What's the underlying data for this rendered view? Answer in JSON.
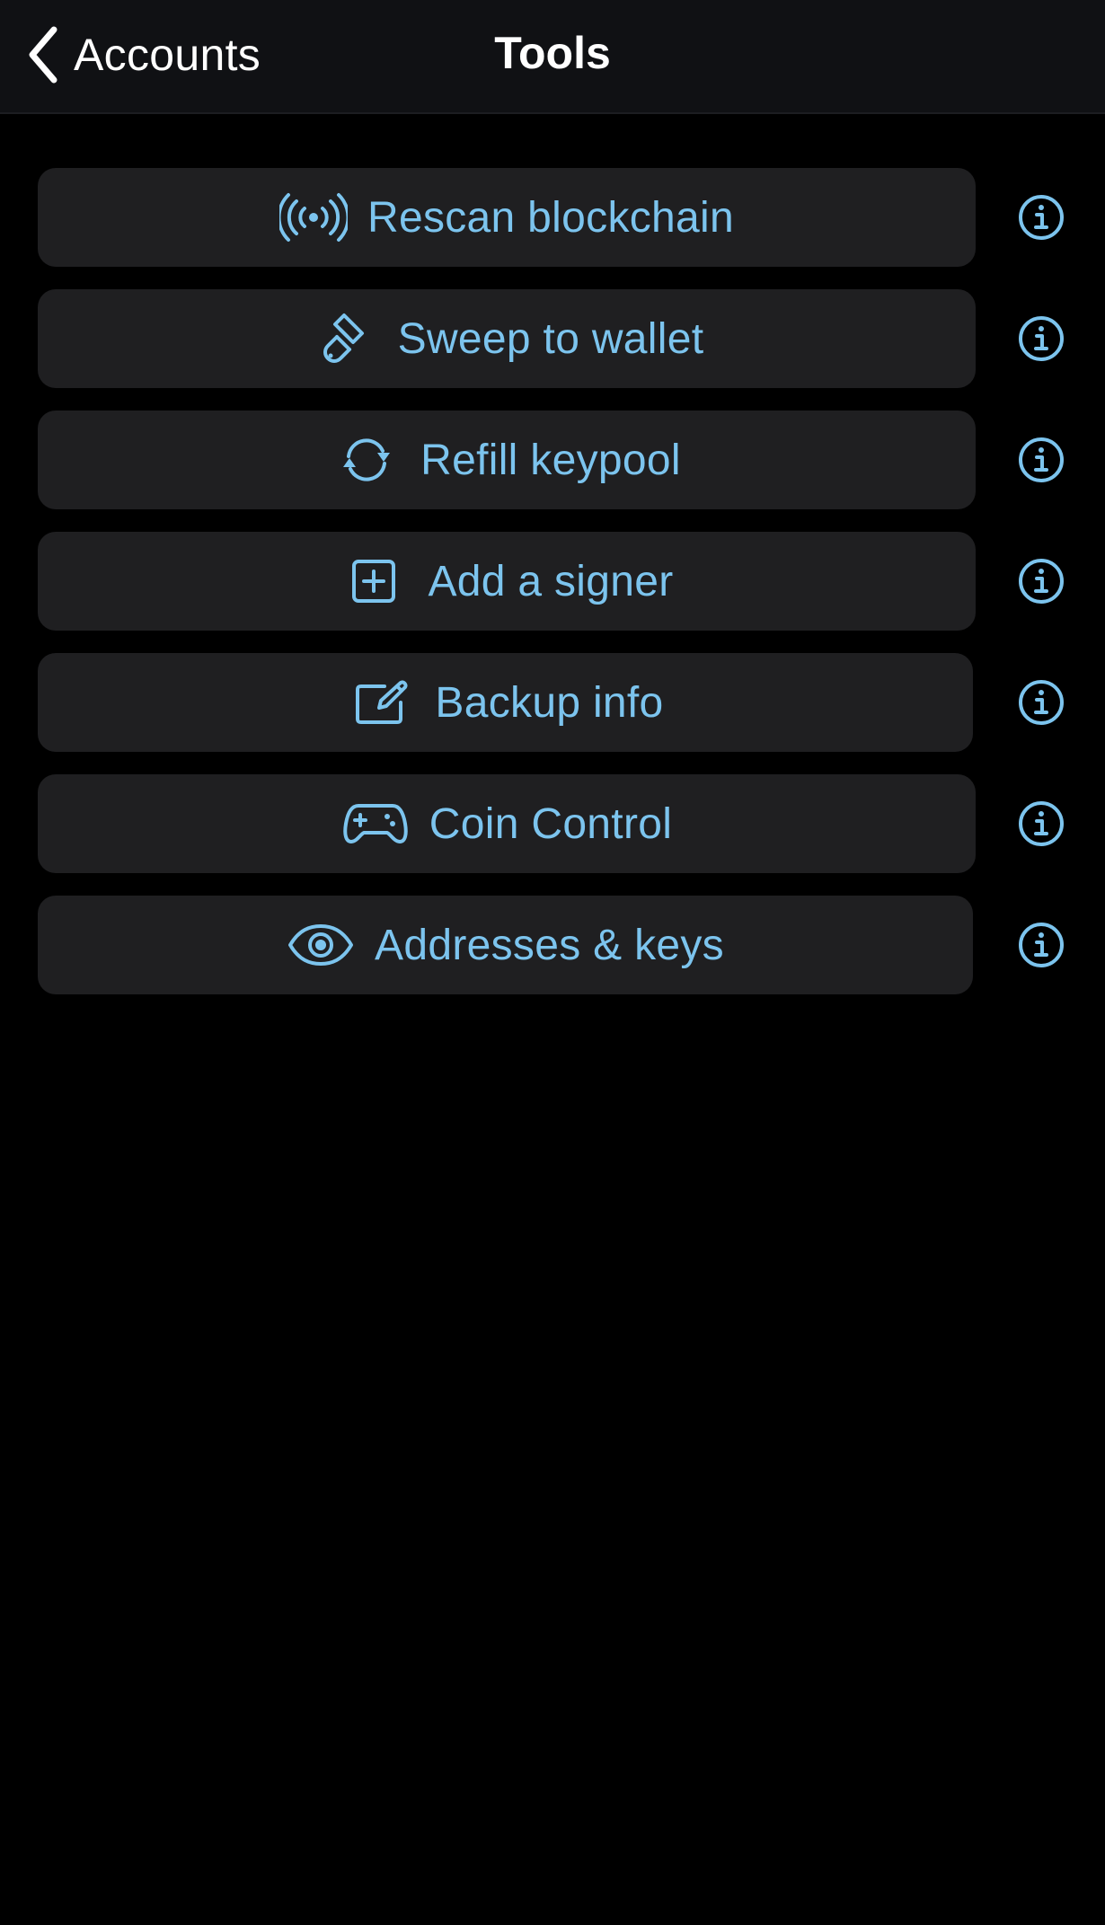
{
  "nav": {
    "back_label": "Accounts",
    "title": "Tools"
  },
  "tools": [
    {
      "label": "Rescan blockchain",
      "icon": "broadcast-icon"
    },
    {
      "label": "Sweep to wallet",
      "icon": "paintbrush-icon"
    },
    {
      "label": "Refill keypool",
      "icon": "refresh-icon"
    },
    {
      "label": "Add a signer",
      "icon": "plus-square-icon"
    },
    {
      "label": "Backup info",
      "icon": "edit-icon"
    },
    {
      "label": "Coin Control",
      "icon": "gamepad-icon"
    },
    {
      "label": "Addresses & keys",
      "icon": "eye-icon"
    }
  ],
  "colors": {
    "accent": "#7cc4ee",
    "background": "#000000",
    "navbar": "#101114",
    "button": "#1f1f21"
  }
}
